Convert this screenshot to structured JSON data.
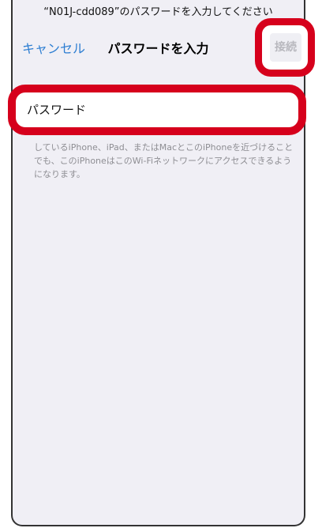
{
  "prompt": "“N01J-cdd089”のパスワードを入力してください",
  "nav": {
    "cancel_label": "キャンセル",
    "title": "パスワードを入力",
    "connect_label": "接続"
  },
  "password_field": {
    "placeholder": "パスワード"
  },
  "description": "しているiPhone、iPad、またはMacとこのiPhoneを近づけることでも、このiPhoneはこのWi-Fiネットワークにアクセスできるようになります。"
}
